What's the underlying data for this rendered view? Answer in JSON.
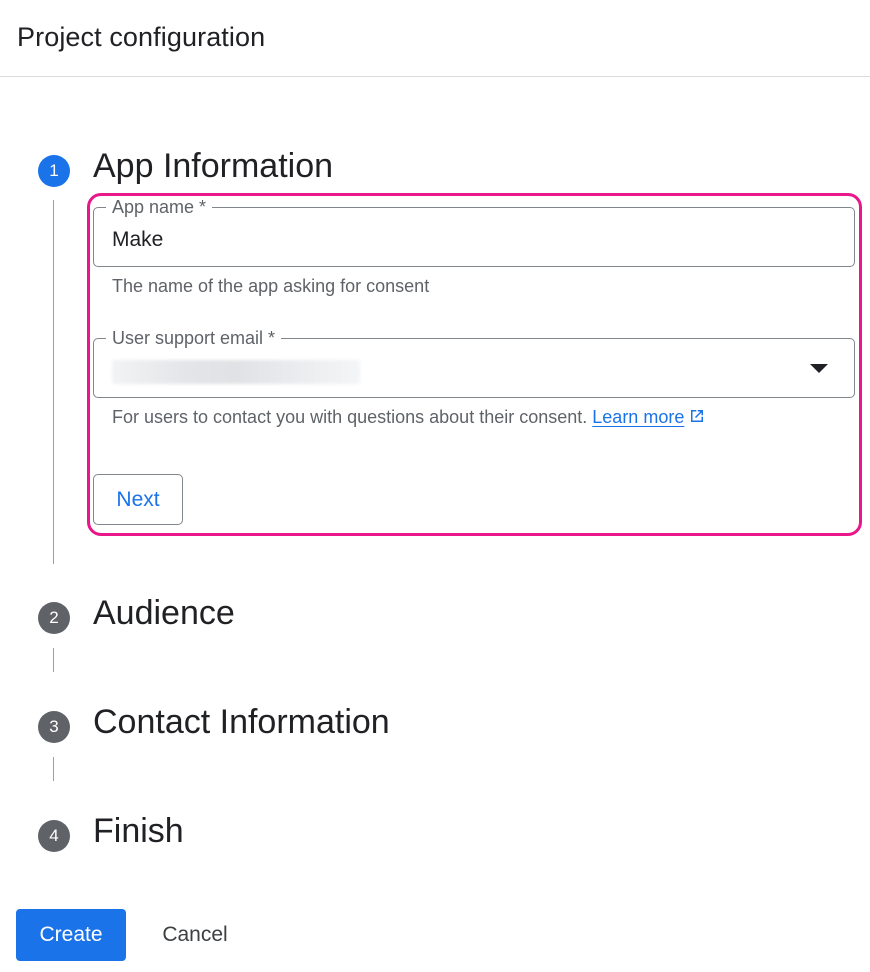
{
  "header": {
    "title": "Project configuration"
  },
  "steps": [
    {
      "number": "1",
      "title": "App Information"
    },
    {
      "number": "2",
      "title": "Audience"
    },
    {
      "number": "3",
      "title": "Contact Information"
    },
    {
      "number": "4",
      "title": "Finish"
    }
  ],
  "app_info": {
    "app_name": {
      "label": "App name *",
      "value": "Make",
      "helper": "The name of the app asking for consent"
    },
    "support_email": {
      "label": "User support email *",
      "value": "",
      "helper": "For users to contact you with questions about their consent.",
      "link_text": "Learn more"
    },
    "next_label": "Next"
  },
  "footer": {
    "create_label": "Create",
    "cancel_label": "Cancel"
  },
  "colors": {
    "primary": "#1a73e8",
    "highlight": "#e8178a",
    "inactive_step": "#5f6368"
  },
  "icons": [
    "external-link-icon",
    "dropdown-caret-icon"
  ]
}
